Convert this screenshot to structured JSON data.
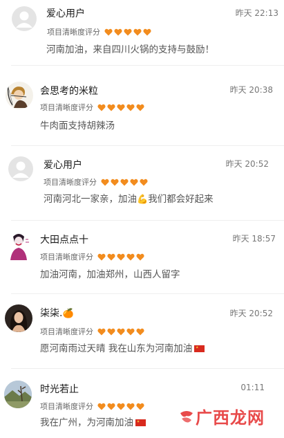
{
  "rating_label": "项目清晰度评分",
  "rating_value": 5,
  "rating_max": 5,
  "heart_color": "#f28c1e",
  "comments": [
    {
      "user": "爱心用户",
      "time": "昨天 22:13",
      "text": "河南加油，来自四川火锅的支持与鼓励！",
      "avatar": "default-avatar-icon"
    },
    {
      "user": "会思考的米粒",
      "time": "昨天 20:38",
      "text": "牛肉面支持胡辣汤",
      "avatar": "archer-avatar"
    },
    {
      "user": "爱心用户",
      "time": "昨天 20:52",
      "text_before": "河南河北一家亲，加油",
      "emoji": "💪",
      "text_after": "我们都会好起来",
      "avatar": "default-avatar-icon"
    },
    {
      "user": "大田点点十",
      "time": "昨天 18:57",
      "text": "加油河南，加油郑州，山西人留字",
      "avatar": "joker-avatar"
    },
    {
      "user": "柒柒.",
      "user_emoji": "🍊",
      "time": "昨天 20:52",
      "text": "愿河南雨过天晴 我在山东为河南加油",
      "avatar": "woman-avatar"
    },
    {
      "user": "时光若止",
      "time": "01:11",
      "text": "我在广州，为河南加油",
      "avatar": "landscape-avatar"
    }
  ],
  "watermark": "广西龙网"
}
